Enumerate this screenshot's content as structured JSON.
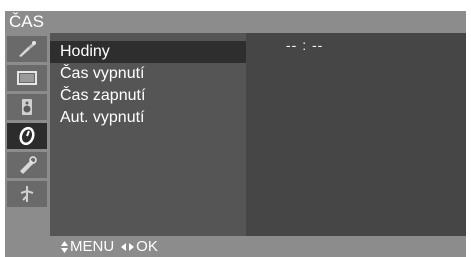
{
  "header": {
    "title": "ČAS"
  },
  "sidebar": {
    "icons": [
      {
        "name": "picture-adjust-icon"
      },
      {
        "name": "screen-icon"
      },
      {
        "name": "audio-icon"
      },
      {
        "name": "time-icon",
        "active": true
      },
      {
        "name": "option-icon"
      },
      {
        "name": "setup-icon"
      }
    ]
  },
  "menu": {
    "items": [
      {
        "label": "Hodiny",
        "selected": true
      },
      {
        "label": "Čas vypnutí"
      },
      {
        "label": "Čas zapnutí"
      },
      {
        "label": "Aut. vypnutí"
      }
    ]
  },
  "value": {
    "clock": "-- : --"
  },
  "footer": {
    "menu_label": "MENU",
    "ok_label": "OK"
  }
}
